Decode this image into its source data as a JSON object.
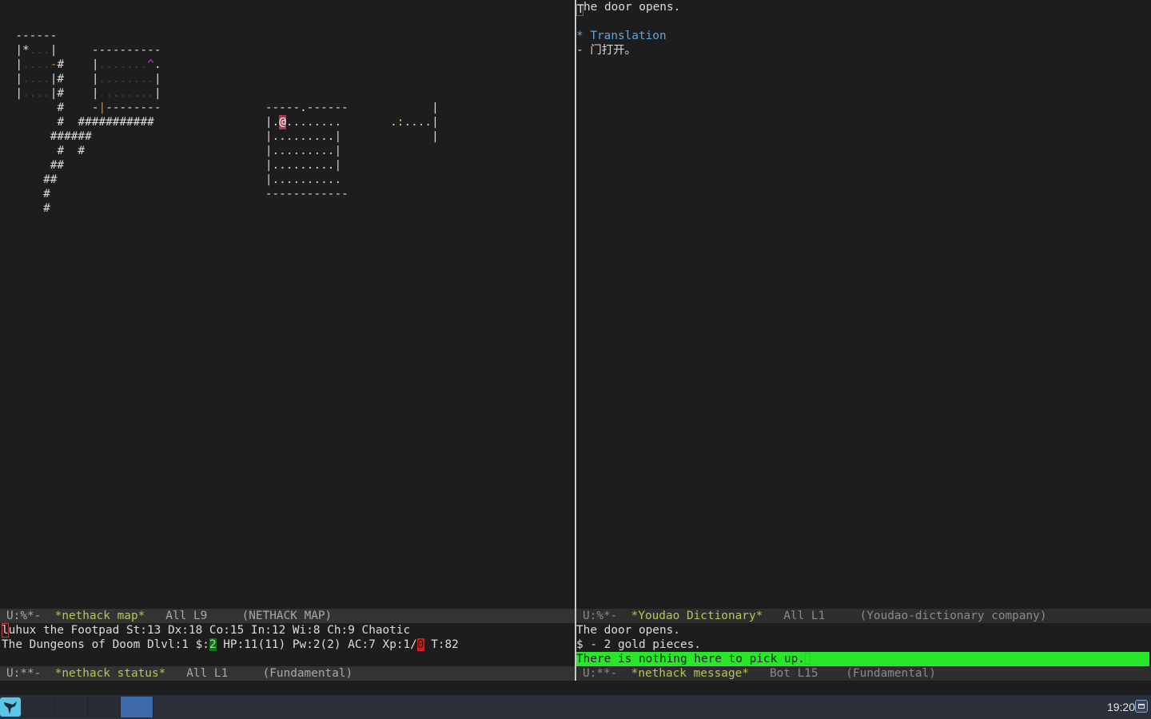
{
  "map_window": {
    "lines": [
      {
        "row": 2,
        "segments": [
          {
            "col": 2,
            "text": "------",
            "cls": "c-wall"
          }
        ]
      },
      {
        "row": 3,
        "segments": [
          {
            "col": 2,
            "text": "|*",
            "cls": "c-wall"
          },
          {
            "col": 4,
            "text": "...",
            "cls": "c-dark"
          },
          {
            "col": 7,
            "text": "|",
            "cls": "c-wall"
          },
          {
            "col": 13,
            "text": "----------",
            "cls": "c-wall"
          }
        ]
      },
      {
        "row": 4,
        "segments": [
          {
            "col": 2,
            "text": "|",
            "cls": "c-wall"
          },
          {
            "col": 3,
            "text": "....",
            "cls": "c-dark"
          },
          {
            "col": 7,
            "text": "-",
            "cls": "c-orange"
          },
          {
            "col": 8,
            "text": "#",
            "cls": "c-wall"
          },
          {
            "col": 13,
            "text": "|",
            "cls": "c-wall"
          },
          {
            "col": 14,
            "text": ".......",
            "cls": "c-dark"
          },
          {
            "col": 21,
            "text": "^",
            "cls": "c-magenta"
          },
          {
            "col": 22,
            "text": ".",
            "cls": "c-wall"
          }
        ]
      },
      {
        "row": 5,
        "segments": [
          {
            "col": 2,
            "text": "|",
            "cls": "c-wall"
          },
          {
            "col": 3,
            "text": "....",
            "cls": "c-dark"
          },
          {
            "col": 7,
            "text": "|#",
            "cls": "c-wall"
          },
          {
            "col": 13,
            "text": "|",
            "cls": "c-wall"
          },
          {
            "col": 14,
            "text": "........",
            "cls": "c-dark"
          },
          {
            "col": 22,
            "text": "|",
            "cls": "c-wall"
          }
        ]
      },
      {
        "row": 6,
        "segments": [
          {
            "col": 2,
            "text": "|",
            "cls": "c-wall"
          },
          {
            "col": 3,
            "text": "....",
            "cls": "c-dark"
          },
          {
            "col": 7,
            "text": "|#",
            "cls": "c-wall"
          },
          {
            "col": 13,
            "text": "|",
            "cls": "c-wall"
          },
          {
            "col": 14,
            "text": "........",
            "cls": "c-dark"
          },
          {
            "col": 22,
            "text": "|",
            "cls": "c-wall"
          }
        ]
      },
      {
        "row": 7,
        "segments": [
          {
            "col": 8,
            "text": "#",
            "cls": "c-wall"
          },
          {
            "col": 13,
            "text": "-",
            "cls": "c-wall"
          },
          {
            "col": 14,
            "text": "|",
            "cls": "c-orange"
          },
          {
            "col": 15,
            "text": "--------",
            "cls": "c-wall"
          },
          {
            "col": 38,
            "text": "-----.------",
            "cls": "c-wall"
          },
          {
            "col": 62,
            "text": "|",
            "cls": "c-wall"
          }
        ]
      },
      {
        "row": 8,
        "segments": [
          {
            "col": 8,
            "text": "#",
            "cls": "c-wall"
          },
          {
            "col": 11,
            "text": "###########",
            "cls": "c-wall"
          },
          {
            "col": 38,
            "text": "|.",
            "cls": "c-wall"
          },
          {
            "col": 40,
            "text": "@",
            "cls": "c-player"
          },
          {
            "col": 41,
            "text": "........",
            "cls": "c-gray"
          },
          {
            "col": 56,
            "text": ".",
            "cls": "c-gray"
          },
          {
            "col": 57,
            "text": ":",
            "cls": "c-yellow"
          },
          {
            "col": 58,
            "text": "....",
            "cls": "c-gray"
          },
          {
            "col": 62,
            "text": "|",
            "cls": "c-wall"
          }
        ]
      },
      {
        "row": 9,
        "segments": [
          {
            "col": 7,
            "text": "######",
            "cls": "c-wall"
          },
          {
            "col": 38,
            "text": "|.........|",
            "cls": "c-gray"
          },
          {
            "col": 62,
            "text": "|",
            "cls": "c-wall"
          }
        ]
      },
      {
        "row": 10,
        "segments": [
          {
            "col": 8,
            "text": "#  #",
            "cls": "c-wall"
          },
          {
            "col": 38,
            "text": "|.........|",
            "cls": "c-gray"
          }
        ]
      },
      {
        "row": 11,
        "segments": [
          {
            "col": 7,
            "text": "##",
            "cls": "c-wall"
          },
          {
            "col": 38,
            "text": "|.........|",
            "cls": "c-gray"
          }
        ]
      },
      {
        "row": 12,
        "segments": [
          {
            "col": 6,
            "text": "##",
            "cls": "c-wall"
          },
          {
            "col": 38,
            "text": "|..........",
            "cls": "c-gray"
          }
        ]
      },
      {
        "row": 13,
        "segments": [
          {
            "col": 6,
            "text": "#",
            "cls": "c-wall"
          },
          {
            "col": 38,
            "text": "------------",
            "cls": "c-wall"
          }
        ]
      },
      {
        "row": 14,
        "segments": [
          {
            "col": 6,
            "text": "#",
            "cls": "c-wall"
          }
        ]
      }
    ]
  },
  "dict_window": {
    "first_line_rest": "he door opens.",
    "first_line_char": "T",
    "heading": "* Translation",
    "translation": "- 门打开。"
  },
  "status_window": {
    "line1_char": "l",
    "line1_rest": "uhux the Footpad St:13 Dx:18 Co:15 In:12 Wi:8 Ch:9 Chaotic",
    "line2_a": "The Dungeons of Doom Dlvl:1 $:",
    "gold": "2",
    "line2_b": " HP:11(11) Pw:2(2) AC:7 Xp:1/",
    "xp_points": "0",
    "line2_c": " T:82"
  },
  "message_window": {
    "lines": [
      "The door opens.",
      "$ - 2 gold pieces."
    ],
    "highlighted": "There is nothing here to pick up."
  },
  "modelines": {
    "map": {
      "state": "U:%*-  ",
      "buffer": "*nethack map*",
      "rest": "   All L9     (NETHACK MAP)"
    },
    "dict": {
      "state": "U:%*-  ",
      "buffer": "*Youdao Dictionary*",
      "rest": "   All L1     (Youdao-dictionary company)"
    },
    "status": {
      "state": "U:**-  ",
      "buffer": "*nethack status*",
      "rest": "   All L1     (Fundamental)"
    },
    "msg": {
      "state": "U:**-  ",
      "buffer": "*nethack message*",
      "rest": "   Bot L15    (Fundamental)"
    }
  },
  "taskbar": {
    "clock": "19:20",
    "start_icon": "bird-icon",
    "show_desktop_icon": "window-icon"
  },
  "colors": {
    "highlight_green": "#28e628",
    "player_bg": "#b13a48",
    "heading_blue": "#5fa6d8"
  }
}
